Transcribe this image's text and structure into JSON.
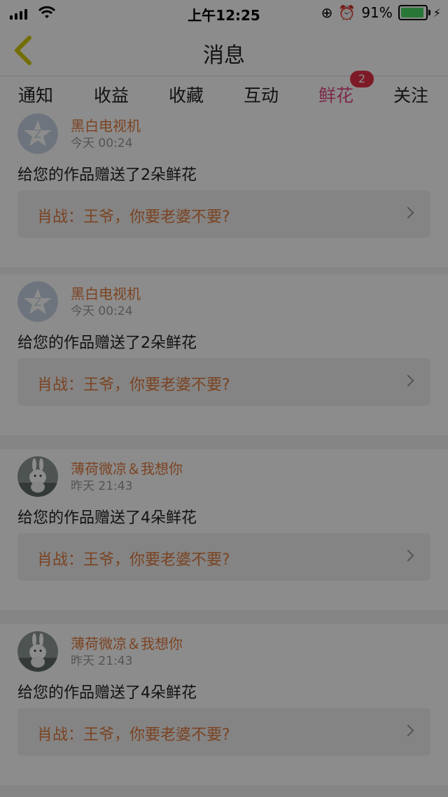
{
  "status_bar": {
    "time": "上午12:25",
    "battery_percent": "91%"
  },
  "nav": {
    "title": "消息"
  },
  "tabs": [
    {
      "label": "通知"
    },
    {
      "label": "收益"
    },
    {
      "label": "收藏"
    },
    {
      "label": "互动"
    },
    {
      "label": "鲜花",
      "active": true,
      "badge": "2"
    },
    {
      "label": "关注"
    }
  ],
  "messages": [
    {
      "avatar_type": "placeholder",
      "name": "黑白电视机",
      "time": "今天 00:24",
      "text": "给您的作品赠送了2朵鲜花",
      "quote": "肖战：王爷，你要老婆不要?"
    },
    {
      "avatar_type": "placeholder",
      "name": "黑白电视机",
      "time": "今天 00:24",
      "text": "给您的作品赠送了2朵鲜花",
      "quote": "肖战：王爷，你要老婆不要?"
    },
    {
      "avatar_type": "bunny",
      "name": "薄荷微凉＆我想你",
      "time": "昨天 21:43",
      "text": "给您的作品赠送了4朵鲜花",
      "quote": "肖战：王爷，你要老婆不要?"
    },
    {
      "avatar_type": "bunny",
      "name": "薄荷微凉＆我想你",
      "time": "昨天 21:43",
      "text": "给您的作品赠送了4朵鲜花",
      "quote": "肖战：王爷，你要老婆不要?"
    }
  ],
  "colors": {
    "accent": "#e34b86",
    "badge": "#e5304a",
    "name": "#e07a3e"
  }
}
